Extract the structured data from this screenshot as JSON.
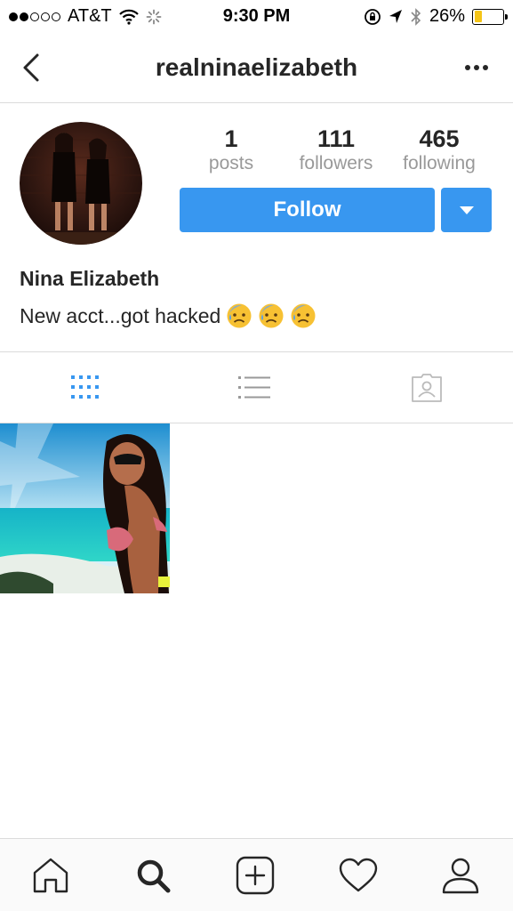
{
  "status_bar": {
    "carrier": "AT&T",
    "time": "9:30 PM",
    "battery": "26%",
    "battery_level": 0.26
  },
  "nav": {
    "title": "realninaelizabeth",
    "back_icon": "chevron-left-icon",
    "more_icon": "more-horizontal-icon"
  },
  "profile": {
    "stats": [
      {
        "value": "1",
        "label": "posts"
      },
      {
        "value": "111",
        "label": "followers"
      },
      {
        "value": "465",
        "label": "following"
      }
    ],
    "follow_label": "Follow",
    "name": "Nina Elizabeth",
    "bio": "New acct...got hacked",
    "bio_emojis": [
      "sad-sweat-face-emoji",
      "sad-sweat-face-emoji",
      "sad-sweat-face-emoji"
    ]
  },
  "view_tabs": [
    "grid-icon",
    "list-icon",
    "tagged-icon"
  ],
  "posts_count_shown": 1,
  "bottom_nav": [
    "home-icon",
    "search-icon",
    "add-icon",
    "heart-icon",
    "profile-icon"
  ],
  "colors": {
    "accent": "#3897f0",
    "muted": "#999999",
    "text": "#262626",
    "divider": "#dbdbdb"
  }
}
